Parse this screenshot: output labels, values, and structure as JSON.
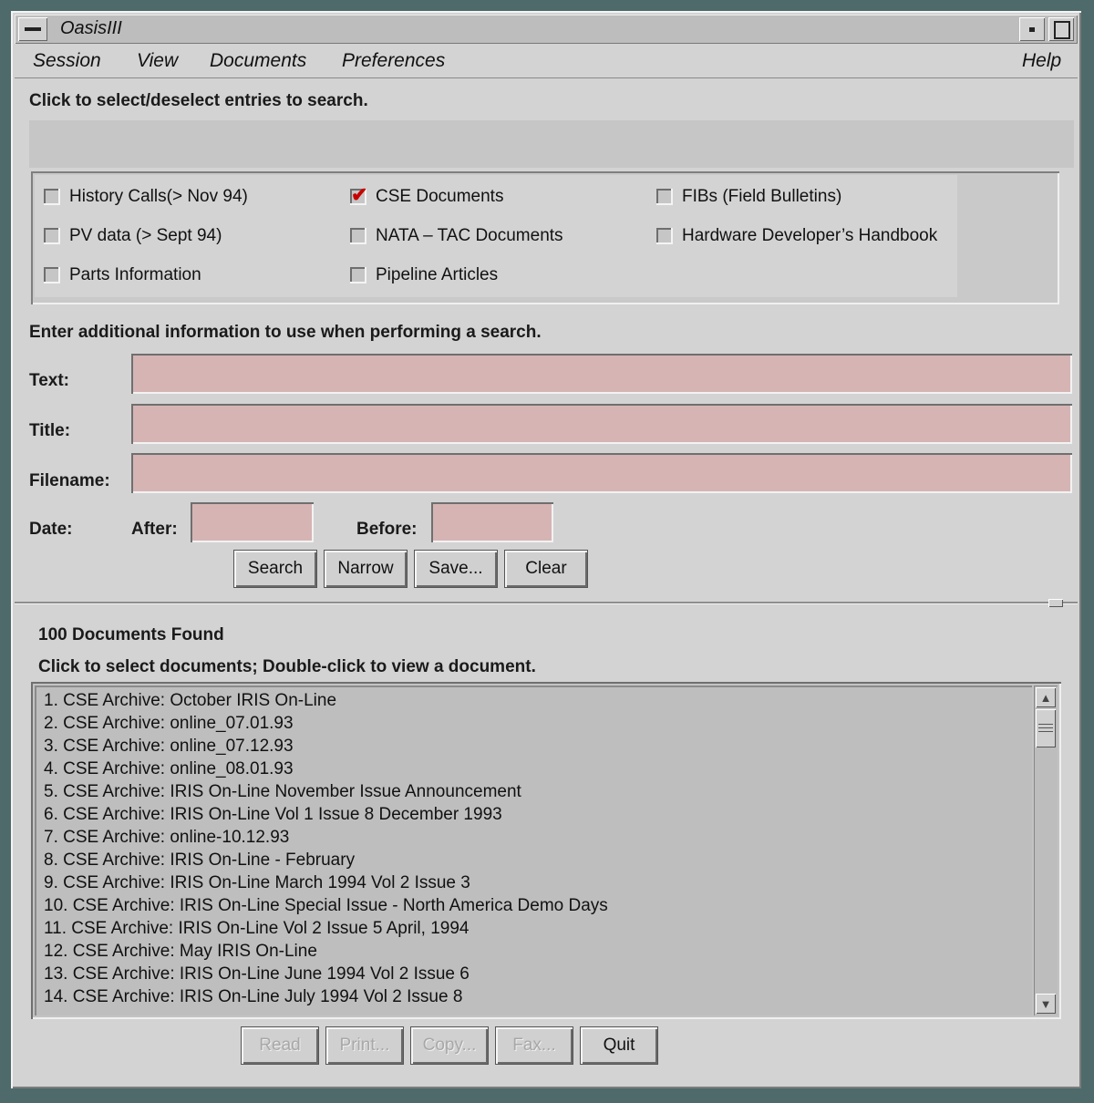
{
  "window": {
    "title": "OasisIII"
  },
  "menubar": {
    "session": "Session",
    "view": "View",
    "documents": "Documents",
    "preferences": "Preferences",
    "help": "Help"
  },
  "search_sources": {
    "instruction": "Click to select/deselect entries to search.",
    "options": [
      {
        "label": "History Calls(> Nov 94)",
        "checked": false
      },
      {
        "label": "CSE Documents",
        "checked": true
      },
      {
        "label": "FIBs (Field Bulletins)",
        "checked": false
      },
      {
        "label": "PV data (> Sept 94)",
        "checked": false
      },
      {
        "label": "NATA – TAC Documents",
        "checked": false
      },
      {
        "label": "Hardware Developer’s Handbook",
        "checked": false
      },
      {
        "label": "Parts Information",
        "checked": false
      },
      {
        "label": "Pipeline Articles",
        "checked": false
      }
    ]
  },
  "search_form": {
    "instruction": "Enter additional information to use when performing a search.",
    "text_label": "Text:",
    "text_value": "",
    "title_label": "Title:",
    "title_value": "",
    "filename_label": "Filename:",
    "filename_value": "",
    "date_label": "Date:",
    "after_label": "After:",
    "after_value": "",
    "before_label": "Before:",
    "before_value": "",
    "buttons": {
      "search": "Search",
      "narrow": "Narrow",
      "save": "Save...",
      "clear": "Clear"
    }
  },
  "results": {
    "count_text": "100 Documents Found",
    "instruction": "Click to select documents; Double-click to view a document.",
    "items": [
      "1.  CSE Archive: October IRIS On-Line",
      "2.  CSE Archive: online_07.01.93",
      "3.  CSE Archive: online_07.12.93",
      "4.  CSE Archive: online_08.01.93",
      "5.  CSE Archive: IRIS On-Line November Issue Announcement",
      "6.  CSE Archive: IRIS On-Line Vol 1 Issue 8 December 1993",
      "7.  CSE Archive: online-10.12.93",
      "8.  CSE Archive: IRIS On-Line - February",
      "9.  CSE Archive: IRIS On-Line March 1994 Vol 2 Issue 3",
      "10.  CSE Archive: IRIS On-Line Special Issue - North America Demo Days",
      "11.  CSE Archive: IRIS On-Line Vol 2 Issue 5 April, 1994",
      "12.  CSE Archive: May IRIS On-Line",
      "13.  CSE Archive: IRIS On-Line June 1994 Vol 2 Issue 6",
      "14.  CSE Archive: IRIS On-Line July 1994 Vol 2 Issue 8"
    ],
    "buttons": {
      "read": "Read",
      "print": "Print...",
      "copy": "Copy...",
      "fax": "Fax...",
      "quit": "Quit"
    }
  }
}
